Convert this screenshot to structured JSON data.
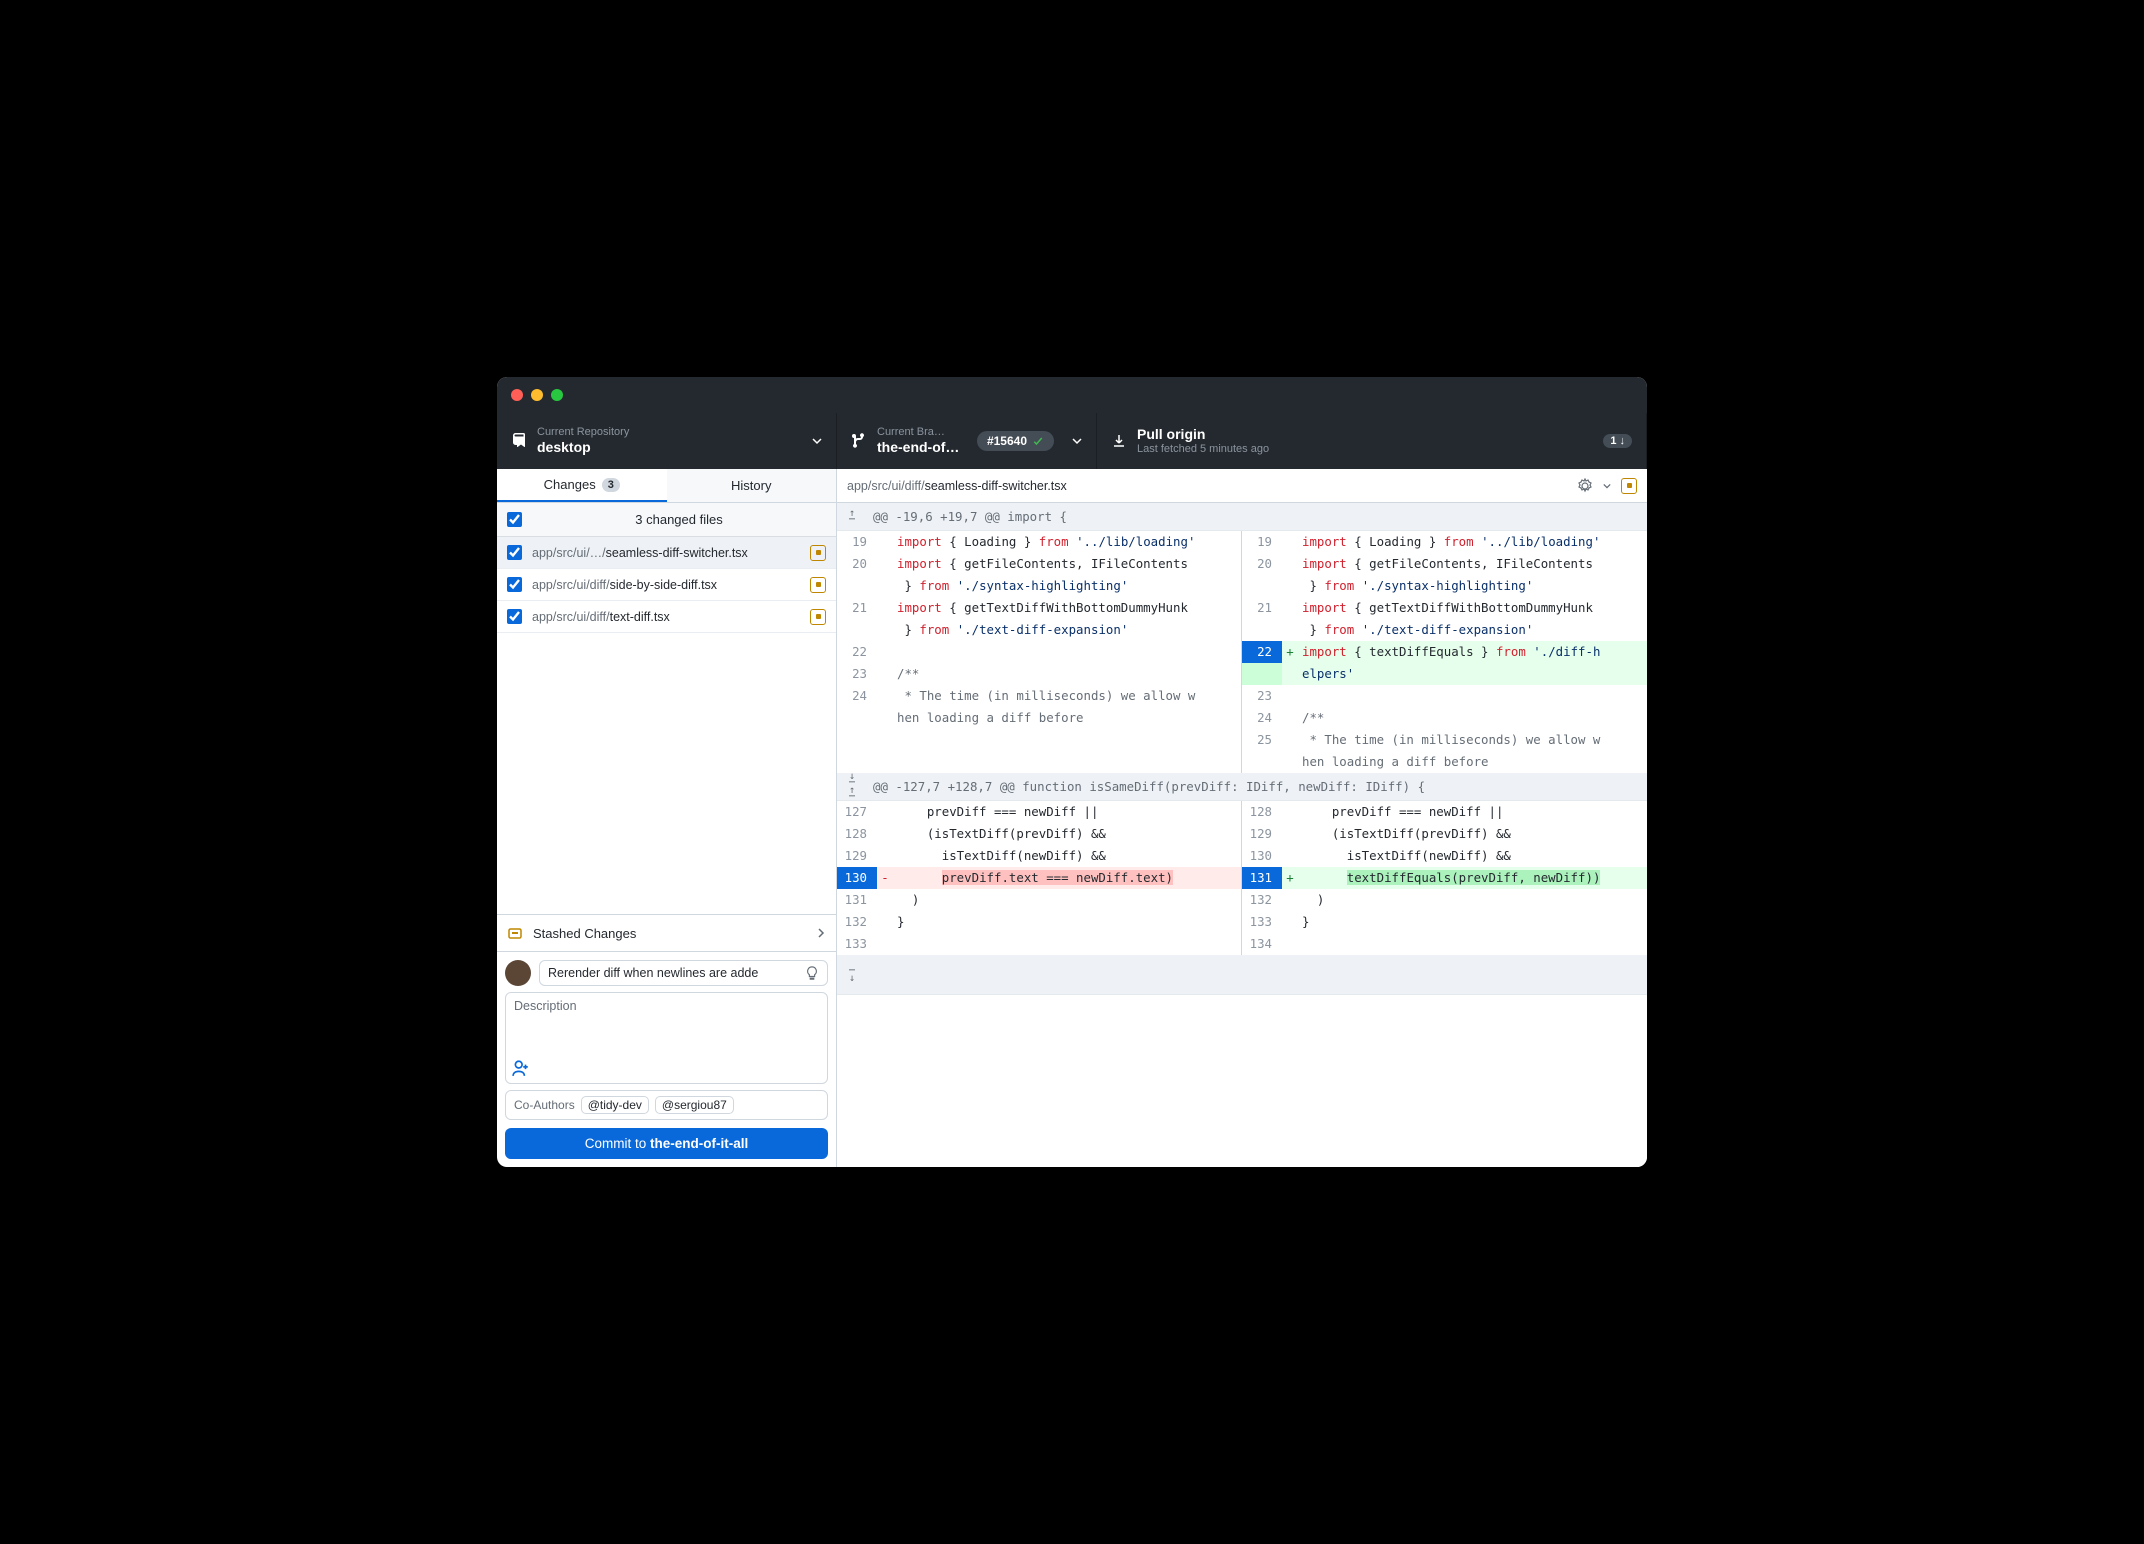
{
  "toolbar": {
    "repo_label": "Current Repository",
    "repo_name": "desktop",
    "branch_label": "Current Bra…",
    "branch_name": "the-end-of…",
    "pr_number": "#15640",
    "pull_label": "Pull origin",
    "pull_sub": "Last fetched 5 minutes ago",
    "pull_badge": "1 ↓"
  },
  "tabs": {
    "changes": "Changes",
    "changes_count": "3",
    "history": "History"
  },
  "files": {
    "header": "3 changed files",
    "items": [
      {
        "prefix": "app/src/ui/…/",
        "name": "seamless-diff-switcher.tsx",
        "selected": true
      },
      {
        "prefix": "app/src/ui/diff/",
        "name": "side-by-side-diff.tsx",
        "selected": false
      },
      {
        "prefix": "app/src/ui/diff/",
        "name": "text-diff.tsx",
        "selected": false
      }
    ]
  },
  "stash_label": "Stashed Changes",
  "commit": {
    "summary_placeholder": "Rerender diff when newlines are adde",
    "description_placeholder": "Description",
    "coauthors_label": "Co-Authors",
    "coauthors": [
      "@tidy-dev",
      "@sergiou87"
    ],
    "button_prefix": "Commit to ",
    "button_branch": "the-end-of-it-all"
  },
  "diff": {
    "path_prefix": "app/src/ui/diff/",
    "path_name": "seamless-diff-switcher.tsx",
    "hunks": [
      {
        "header": "@@ -19,6 +19,7 @@ import {",
        "expand_up": true,
        "lines": [
          {
            "old": 19,
            "new": 19,
            "type": "ctx",
            "html": "<span class='kw'>import</span> { Loading } <span class='kw'>from</span> <span class='str'>'../lib/loading'</span>"
          },
          {
            "old": 20,
            "new": 20,
            "type": "ctx",
            "html": "<span class='kw'>import</span> { getFileContents, IFileContents } <span class='kw'>from</span> <span class='str'>'./syntax-highlighting'</span>",
            "wrap_old": "<span class='kw'>import</span> { getFileContents, IFileContents",
            "wrap_old2": " } <span class='kw'>from</span> <span class='str'>'./syntax-highlighting'</span>",
            "wrap_new": "<span class='kw'>import</span> { getFileContents, IFileContents",
            "wrap_new2": " } <span class='kw'>from</span> <span class='str'>'./syntax-highlighting'</span>"
          },
          {
            "old": 21,
            "new": 21,
            "type": "ctx",
            "html": "<span class='kw'>import</span> { getTextDiffWithBottomDummyHunk } <span class='kw'>from</span> <span class='str'>'./text-diff-expansion'</span>",
            "wrap_old": "<span class='kw'>import</span> { getTextDiffWithBottomDummyHunk",
            "wrap_old2": " } <span class='kw'>from</span> <span class='str'>'./text-diff-expansion'</span>",
            "wrap_new": "<span class='kw'>import</span> { getTextDiffWithBottomDummyHunk",
            "wrap_new2": " } <span class='kw'>from</span> <span class='str'>'./text-diff-expansion'</span>"
          },
          {
            "old": null,
            "new": 22,
            "type": "add",
            "focus": true,
            "html": "<span class='kw'>import</span> { textDiffEquals } <span class='kw'>from</span> <span class='str'>'./diff-h</span>",
            "html2": "<span class='str'>elpers'</span>"
          },
          {
            "old": 22,
            "new": 23,
            "type": "ctx",
            "html": ""
          },
          {
            "old": 23,
            "new": 24,
            "type": "ctx",
            "html": "<span class='cmt'>/**</span>"
          },
          {
            "old": 24,
            "new": 25,
            "type": "ctx",
            "html": "<span class='cmt'> * The time (in milliseconds) we allow w</span>",
            "html_ov": "<span class='cmt'> * The time (in milliseconds) we allow w</span>",
            "cont_old": "<span class='cmt'>hen loading a diff before</span>",
            "cont_new": "<span class='cmt'>hen loading a diff before</span>"
          }
        ]
      },
      {
        "header": "@@ -127,7 +128,7 @@ function isSameDiff(prevDiff: IDiff, newDiff: IDiff) {",
        "expand_mid": true,
        "lines": [
          {
            "old": 127,
            "new": 128,
            "type": "ctx",
            "html": "    prevDiff === newDiff ||"
          },
          {
            "old": 128,
            "new": 129,
            "type": "ctx",
            "html": "    (isTextDiff(prevDiff) &amp;&amp;"
          },
          {
            "old": 129,
            "new": 130,
            "type": "ctx",
            "html": "      isTextDiff(newDiff) &amp;&amp;"
          },
          {
            "old": 130,
            "new": null,
            "type": "del",
            "focus": true,
            "html": "      <span class='highlight-red'>prevDiff.text === newDiff.text)</span>",
            "pair_new": 131,
            "pair_html": "      <span class='highlight-green'>textDiffEquals(prevDiff, newDiff))</span>"
          },
          {
            "old": 131,
            "new": 132,
            "type": "ctx",
            "html": "  )"
          },
          {
            "old": 132,
            "new": 133,
            "type": "ctx",
            "html": "}"
          },
          {
            "old": 133,
            "new": 134,
            "type": "ctx",
            "html": ""
          }
        ]
      }
    ]
  }
}
